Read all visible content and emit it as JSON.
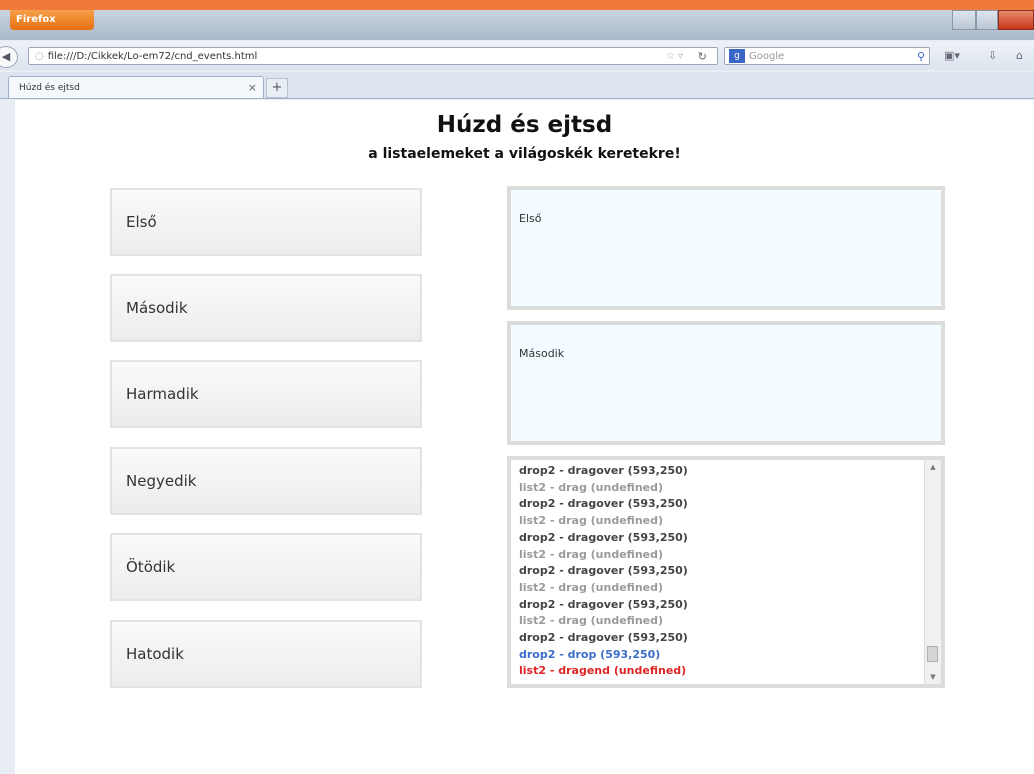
{
  "browser": {
    "menu_button": "Firefox",
    "url": "file:///D:/Cikkek/Lo-em72/cnd_events.html",
    "search_placeholder": "Google",
    "tab_title": "Húzd és ejtsd",
    "new_tab_symbol": "+",
    "tab_close_symbol": "×"
  },
  "page": {
    "title": "Húzd és ejtsd",
    "subtitle": "a listaelemeket a világoskék keretekre!"
  },
  "list": {
    "items": [
      "Első",
      "Második",
      "Harmadik",
      "Negyedik",
      "Ötödik",
      "Hatodik"
    ]
  },
  "drop_zones": [
    {
      "content": "Első"
    },
    {
      "content": "Második"
    }
  ],
  "event_log": {
    "lines": [
      {
        "text": "drop2 - dragover (593,250)",
        "type": "dragover"
      },
      {
        "text": "list2 - drag (undefined)",
        "type": "drag"
      },
      {
        "text": "drop2 - dragover (593,250)",
        "type": "dragover"
      },
      {
        "text": "list2 - drag (undefined)",
        "type": "drag"
      },
      {
        "text": "drop2 - dragover (593,250)",
        "type": "dragover"
      },
      {
        "text": "list2 - drag (undefined)",
        "type": "drag"
      },
      {
        "text": "drop2 - dragover (593,250)",
        "type": "dragover"
      },
      {
        "text": "list2 - drag (undefined)",
        "type": "drag"
      },
      {
        "text": "drop2 - dragover (593,250)",
        "type": "dragover"
      },
      {
        "text": "list2 - drag (undefined)",
        "type": "drag"
      },
      {
        "text": "drop2 - dragover (593,250)",
        "type": "dragover"
      },
      {
        "text": "drop2 - drop (593,250)",
        "type": "drop"
      },
      {
        "text": "list2 - dragend (undefined)",
        "type": "dragend"
      }
    ]
  },
  "colors": {
    "frame": "#f07a3c",
    "drop_zone_bg": "#f2fbff",
    "log_drop": "#3b6ec9",
    "log_dragend": "#e02525"
  }
}
